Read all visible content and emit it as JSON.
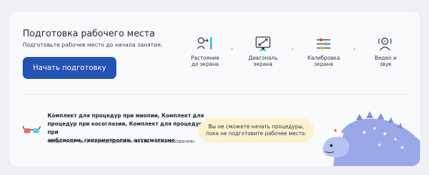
{
  "header": {
    "title": "Подготовка рабочего места",
    "subtitle": "Подготовьте рабочее место до начала занятия.",
    "start_button": "Начать подготовку"
  },
  "steps": [
    {
      "icon": "distance-icon",
      "label_line1": "Растояние",
      "label_line2": "до экрана"
    },
    {
      "icon": "diagonal-icon",
      "label_line1": "Диагональ",
      "label_line2": "экрана"
    },
    {
      "icon": "calibration-icon",
      "label_line1": "Калибровка",
      "label_line2": "экрана"
    },
    {
      "icon": "video-sound-icon",
      "label_line1": "Видео и",
      "label_line2": "звук"
    }
  ],
  "kit": {
    "icon": "glasses-icon",
    "line1": "Комплект для процедур при миопии, Комплект для",
    "line2": "процедур при косоглазии, Комплект для процедур при",
    "line3": "амблиопии, гиперметропии, астигматизме",
    "note": "Убедитесь, что очки подобраны и готовы к использованию."
  },
  "bubble": {
    "line1": "Вы не сможете начать процедуры,",
    "line2": "пока не подготовите рабочее место."
  },
  "colors": {
    "primary": "#2453b3",
    "card": "#f9fafc",
    "bubble": "#fdf2cf",
    "mascot": "#9aa8e8"
  }
}
